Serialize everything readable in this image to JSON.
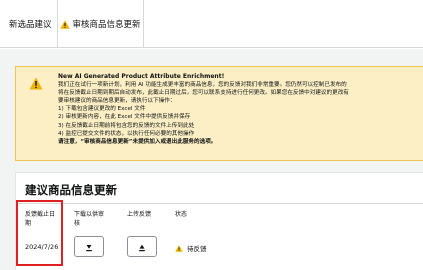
{
  "tabs": [
    {
      "label": "新选品建议",
      "icon": ""
    },
    {
      "label": "审核商品信息更新",
      "icon": "warning-icon"
    }
  ],
  "alert": {
    "icon": "warning-icon",
    "title": "New AI Generated Product Attribute Enrichment!",
    "lines": [
      "我们正在试行一项新计划，利用 AI 功能生成更丰富的商品信息，您的反馈对我们非常重要。您仍然可以控制已发布的",
      "将在反馈截止日期到期后自动发布，此截止日期过后，您可以联系支持进行任何更改。如果您在反馈中对建议的更改有",
      "要审核建议的商品信息更新，请执行以下操作：",
      "1) 下载包含建议更改的 Excel 文件",
      "2) 审核更新内容，在此 Excel 文件中提供反馈并保存",
      "3) 在反馈截止日期前将包含您的反馈的文件上传到此处",
      "4) 监控已提交文件的状态，以执行任何必要的其他操作"
    ],
    "footer": "请注意，“审核商品信息更新”未提供加入或退出此服务的选项。"
  },
  "section": {
    "title": "建议商品信息更新",
    "columns": [
      "反馈截止日期",
      "下载以供审核",
      "上传反馈",
      "状态"
    ],
    "rows": [
      {
        "deadline": "2024/7/26",
        "download_icon": "download-icon",
        "upload_icon": "upload-icon",
        "status": "待反馈",
        "status_icon": "warning-icon"
      }
    ]
  },
  "colors": {
    "alert_bg": "#fcefc6",
    "alert_border": "#f0c64d",
    "warning": "#f0b400",
    "highlight": "#e02020",
    "page_bg": "#f2f3f3"
  }
}
